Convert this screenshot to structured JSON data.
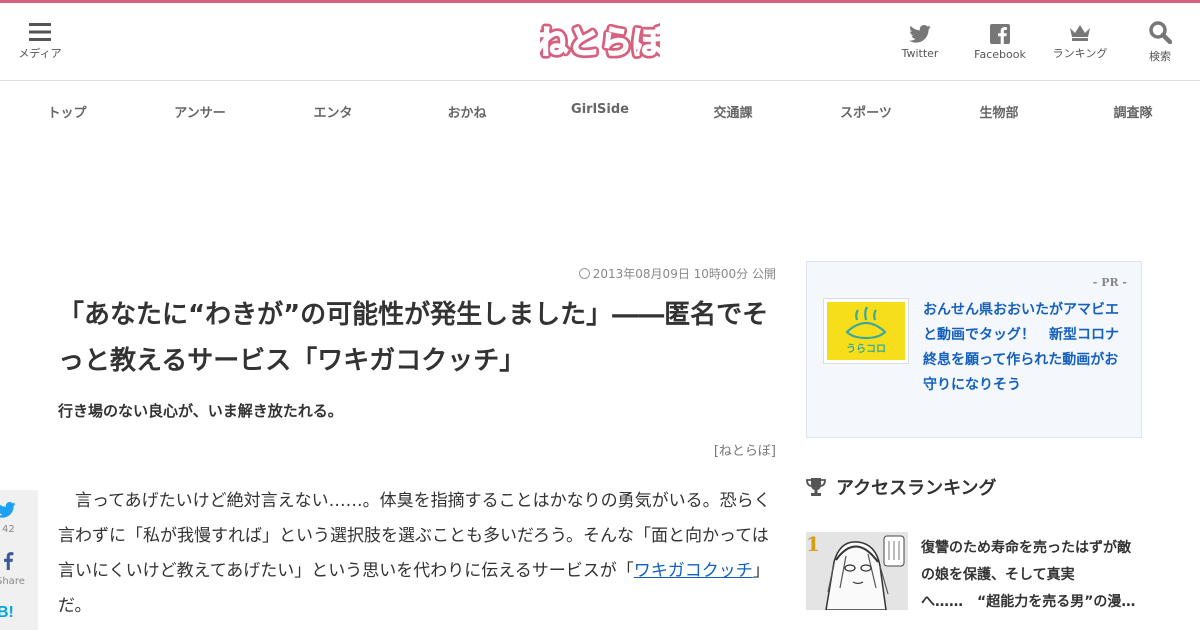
{
  "header": {
    "menu_label": "メディア",
    "logo_text": "ねとらぼ",
    "twitter_label": "Twitter",
    "facebook_label": "Facebook",
    "ranking_label": "ランキング",
    "search_label": "検索"
  },
  "nav": {
    "items": [
      "トップ",
      "アンサー",
      "エンタ",
      "おかね",
      "GirlSide",
      "交通課",
      "スポーツ",
      "生物部",
      "調査隊"
    ]
  },
  "article": {
    "date": "2013年08月09日 10時00分 公開",
    "title": "「あなたに“わきが”の可能性が発生しました」――匿名でそっと教えるサービス「ワキガコクッチ」",
    "subtitle": "行き場のない良心が、いま解き放たれる。",
    "source": "[ねとらぼ]",
    "body_before_link": "言ってあげたいけど絶対言えない……。体臭を指摘することはかなりの勇気がいる。恐らく言わずに「私が我慢すれば」という選択肢を選ぶことも多いだろう。そんな「面と向かっては言いにくいけど教えてあげたい」という思いを代わりに伝えるサービスが「",
    "body_link": "ワキガコクッチ",
    "body_after_link": "」だ。"
  },
  "share": {
    "twitter_count": "42",
    "facebook_label": "Share",
    "hatena_label": "B!"
  },
  "sidebar": {
    "pr_label": "- PR -",
    "pr_thumb_text": "うらコロ",
    "pr_text": "おんせん県おおいたがアマビエと動画でタッグ！　新型コロナ終息を願って作られた動画がお守りになりそう",
    "ranking_title": "アクセスランキング",
    "ranking_items": [
      {
        "rank": "1",
        "text": "復讐のため寿命を売ったはずが敵の娘を保護、そして真実へ……　“超能力を売る男”の漫…"
      }
    ]
  },
  "colors": {
    "brand": "#d8607f",
    "link": "#1560bd",
    "rank_gold": "#d4a017",
    "pr_bg": "#f4f8fc"
  }
}
